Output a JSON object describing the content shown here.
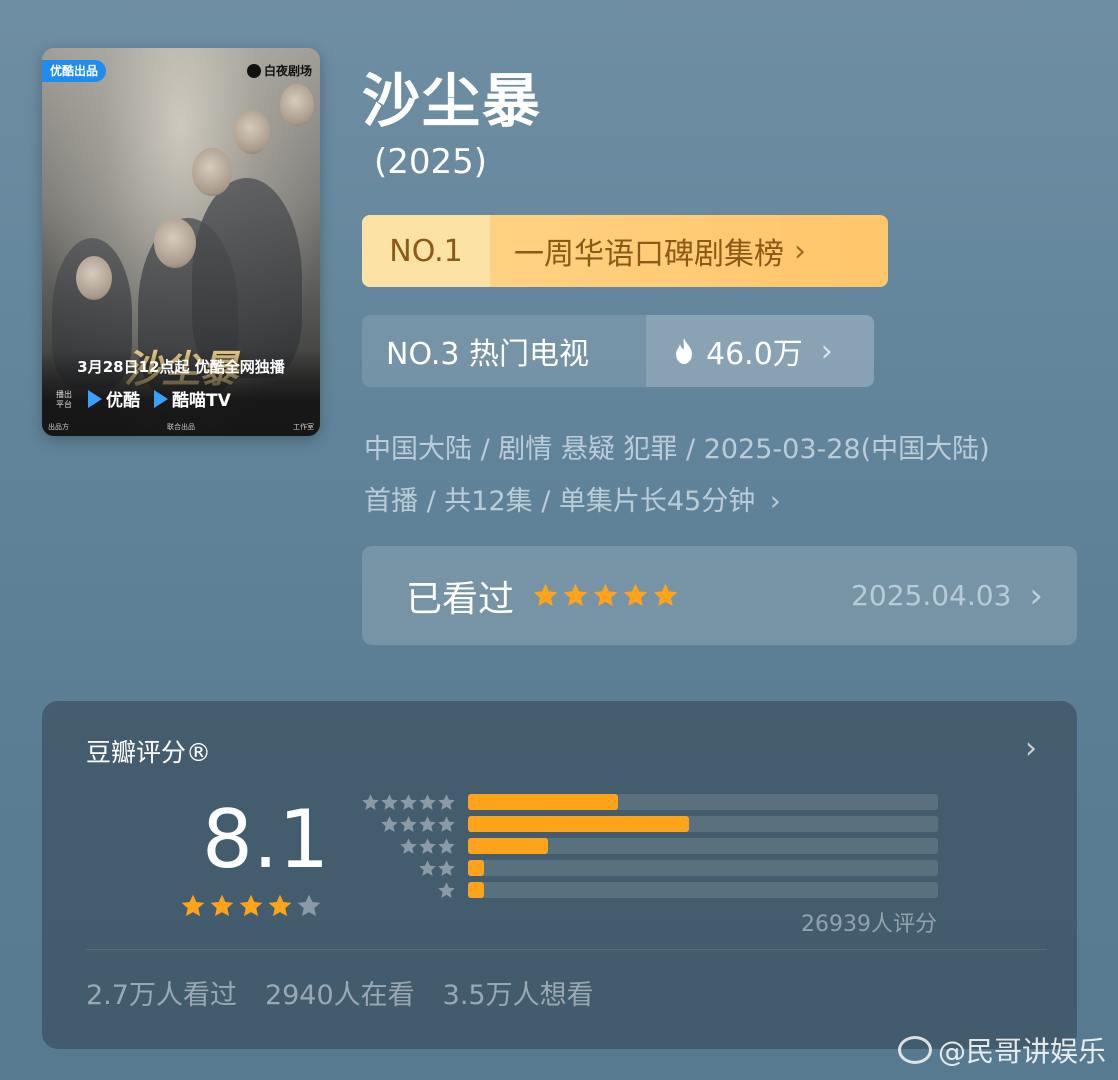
{
  "poster": {
    "badge_left": "优酷出品",
    "badge_right": "白夜剧场",
    "logo": "沙尘暴",
    "release": "3月28日12点起 优酷全网独播",
    "platform1": "优酷",
    "platform2": "酷喵TV",
    "platform_prefix": "播出平台",
    "credits_left": "出品方",
    "credits_mid": "联合出品",
    "credits_right": "工作室"
  },
  "title": "沙尘暴",
  "year": "(2025)",
  "rank1": {
    "no": "NO.1",
    "label": "一周华语口碑剧集榜",
    "chevron": "›"
  },
  "rank2": {
    "no": "NO.3 热门电视",
    "heat": "46.0万",
    "chevron": "›"
  },
  "meta": {
    "line1": "中国大陆 / 剧情 悬疑 犯罪 / 2025-03-28(中国大陆)",
    "line2": "首播 / 共12集 / 单集片长45分钟",
    "chevron": "›"
  },
  "watched": {
    "label": "已看过",
    "stars": 5,
    "date": "2025.04.03",
    "chevron": "›"
  },
  "rating": {
    "title": "豆瓣评分®",
    "chevron": "›",
    "score": "8.1",
    "stars": 4,
    "distribution": [
      {
        "stars": 5,
        "fraction": 0.32
      },
      {
        "stars": 4,
        "fraction": 0.47
      },
      {
        "stars": 3,
        "fraction": 0.17
      },
      {
        "stars": 2,
        "fraction": 0.035
      },
      {
        "stars": 1,
        "fraction": 0.035
      }
    ],
    "count": "26939人评分",
    "stats": [
      "2.7万人看过",
      "2940人在看",
      "3.5万人想看"
    ]
  },
  "watermark": "@民哥讲娱乐",
  "colors": {
    "star_orange": "#ffa31a",
    "star_gray": "#8a9aa6",
    "rank1_bg": "#ffc56a",
    "rank1_text": "#8a5a16"
  }
}
